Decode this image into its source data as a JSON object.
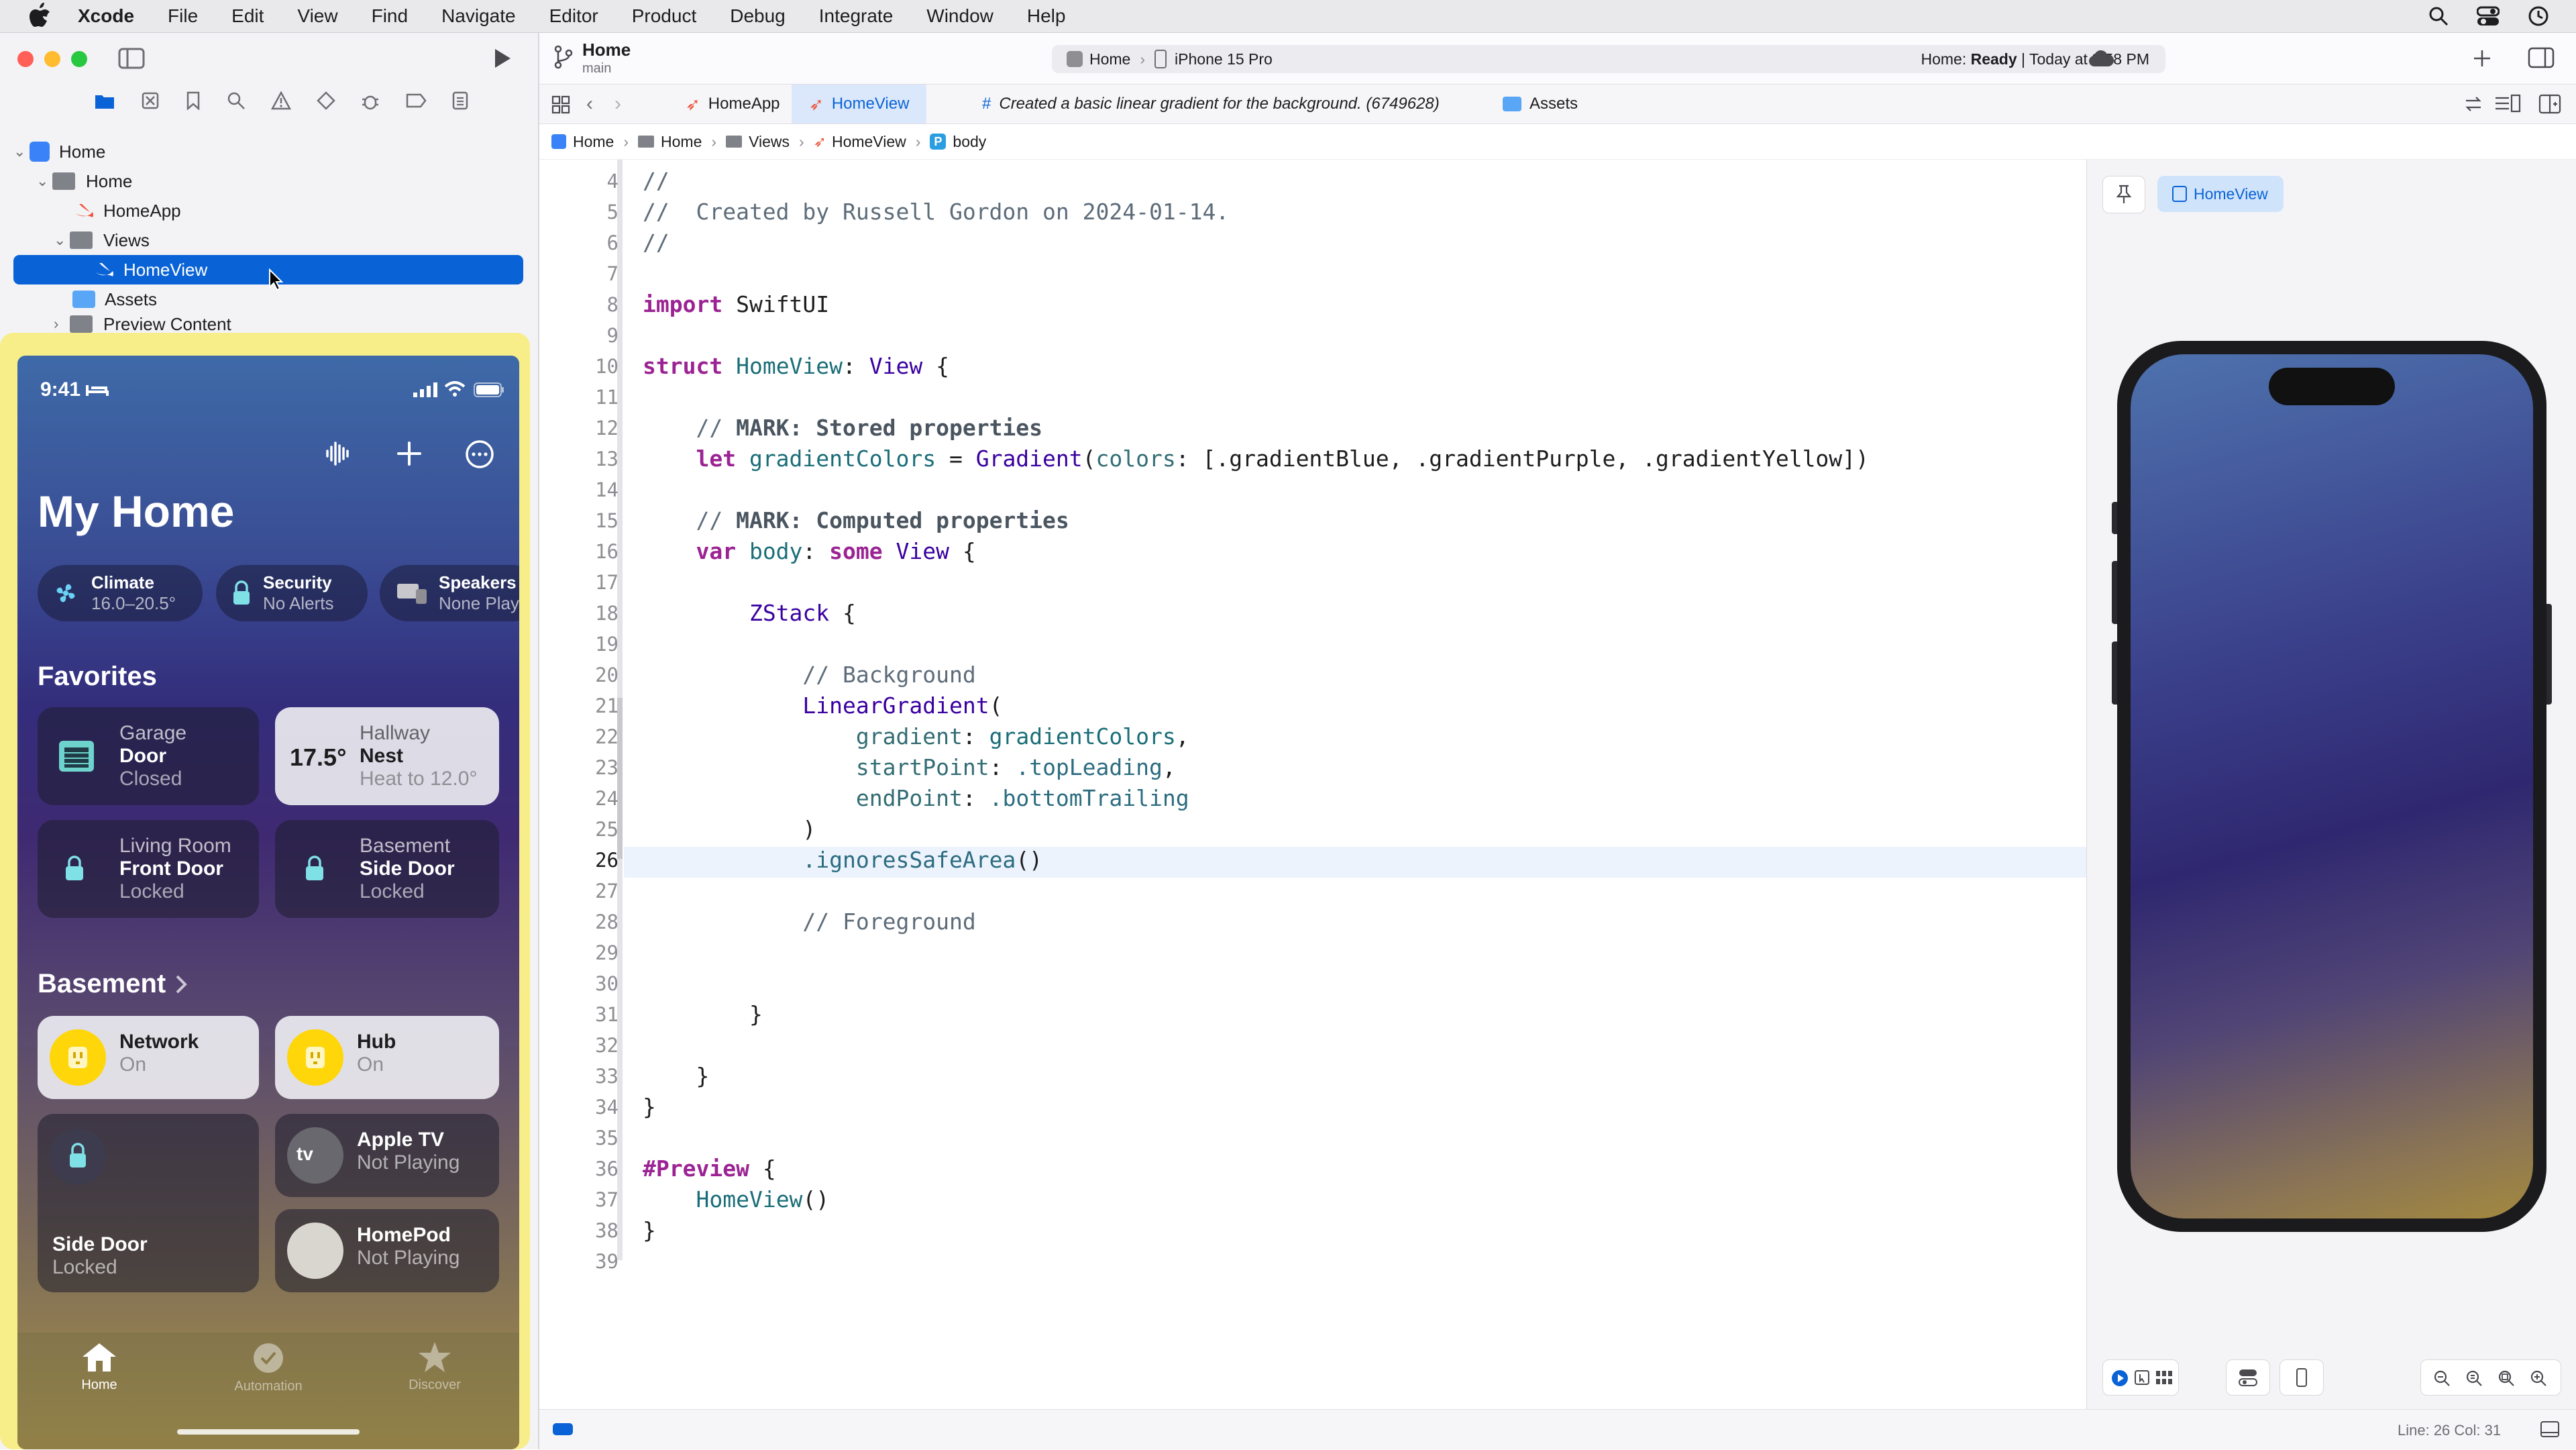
{
  "menubar": {
    "app_name": "Xcode",
    "items": [
      "File",
      "Edit",
      "View",
      "Find",
      "Navigate",
      "Editor",
      "Product",
      "Debug",
      "Integrate",
      "Window",
      "Help"
    ]
  },
  "navigator": {
    "tree": [
      {
        "label": "Home"
      },
      {
        "label": "Home"
      },
      {
        "label": "HomeApp"
      },
      {
        "label": "Views"
      },
      {
        "label": "HomeView"
      },
      {
        "label": "Assets"
      },
      {
        "label": "Preview Content"
      }
    ]
  },
  "simulator": {
    "time": "9:41",
    "title": "My Home",
    "pills": [
      {
        "title": "Climate",
        "sub": "16.0–20.5°"
      },
      {
        "title": "Security",
        "sub": "No Alerts"
      },
      {
        "title": "Speakers",
        "sub": "None Play"
      }
    ],
    "favorites_label": "Favorites",
    "favorites": [
      {
        "room": "Garage",
        "name": "Door",
        "state": "Closed"
      },
      {
        "room": "Hallway",
        "name": "Nest",
        "state": "Heat to 12.0°",
        "value": "17.5°"
      },
      {
        "room": "Living Room",
        "name": "Front Door",
        "state": "Locked"
      },
      {
        "room": "Basement",
        "name": "Side Door",
        "state": "Locked"
      }
    ],
    "basement_label": "Basement",
    "basement": [
      {
        "name": "Network",
        "state": "On"
      },
      {
        "name": "Hub",
        "state": "On"
      },
      {
        "name": "Side Door",
        "state": "Locked"
      },
      {
        "name": "Apple TV",
        "state": "Not Playing",
        "badge": "tv"
      },
      {
        "name": "HomePod",
        "state": "Not Playing"
      }
    ],
    "tabs": [
      {
        "label": "Home"
      },
      {
        "label": "Automation"
      },
      {
        "label": "Discover"
      }
    ]
  },
  "toolbar": {
    "project": "Home",
    "branch": "main",
    "scheme": "Home",
    "device": "iPhone 15 Pro",
    "status_prefix": "Home:",
    "status_state": "Ready",
    "status_time": "| Today at 3:58 PM"
  },
  "tabs": [
    {
      "label": "HomeApp"
    },
    {
      "label": "HomeView"
    },
    {
      "label": "Created a basic linear gradient for the background. (6749628)"
    },
    {
      "label": "Assets"
    }
  ],
  "jumpbar": {
    "items": [
      "Home",
      "Home",
      "Views",
      "HomeView",
      "body"
    ],
    "symbol_badge": "P"
  },
  "code": {
    "current_line": "26",
    "line_numbers": [
      "4",
      "5",
      "6",
      "7",
      "8",
      "9",
      "10",
      "11",
      "12",
      "13",
      "14",
      "15",
      "16",
      "17",
      "18",
      "19",
      "20",
      "21",
      "22",
      "23",
      "24",
      "25",
      "26",
      "27",
      "28",
      "29",
      "30",
      "31",
      "32",
      "33",
      "34",
      "35",
      "36",
      "37",
      "38",
      "39"
    ],
    "lines": {
      "l4": "//",
      "l5": "//  Created by Russell Gordon on 2024-01-14.",
      "l6": "//",
      "l8a": "import",
      "l8b": " SwiftUI",
      "l10a": "struct",
      "l10b": " HomeView",
      "l10c": ": ",
      "l10d": "View",
      "l10e": " {",
      "l12a": "    // ",
      "l12b": "MARK: Stored properties",
      "l13a": "    let",
      "l13b": " gradientColors",
      "l13c": " = ",
      "l13d": "Gradient",
      "l13e": "(",
      "l13f": "colors",
      "l13g": ": [",
      "l13h": ".gradientBlue",
      "l13i": ", ",
      "l13j": ".gradientPurple",
      "l13k": ", ",
      "l13l": ".gradientYellow",
      "l13m": "])",
      "l15a": "    // ",
      "l15b": "MARK: Computed properties",
      "l16a": "    var",
      "l16b": " body",
      "l16c": ": ",
      "l16d": "some",
      "l16e": " View",
      "l16f": " {",
      "l18a": "        ",
      "l18b": "ZStack",
      "l18c": " {",
      "l20": "            // Background",
      "l21a": "            ",
      "l21b": "LinearGradient",
      "l21c": "(",
      "l22a": "                ",
      "l22b": "gradient",
      "l22c": ": ",
      "l22d": "gradientColors",
      "l22e": ",",
      "l23a": "                ",
      "l23b": "startPoint",
      "l23c": ": ",
      "l23d": ".topLeading",
      "l23e": ",",
      "l24a": "                ",
      "l24b": "endPoint",
      "l24c": ": ",
      "l24d": ".bottomTrailing",
      "l25": "            )",
      "l26a": "            ",
      "l26b": ".ignoresSafeArea",
      "l26c": "()",
      "l28": "            // Foreground",
      "l31": "        }",
      "l33": "    }",
      "l34": "}",
      "l36a": "#Preview",
      "l36b": " {",
      "l37a": "    ",
      "l37b": "HomeView",
      "l37c": "()",
      "l38": "}"
    }
  },
  "preview": {
    "pin_icon": "pin-icon",
    "selected_view": "HomeView"
  },
  "status": {
    "position": "Line: 26  Col: 31"
  },
  "colors": {
    "accent": "#0a63d6",
    "keyword": "#9b2393",
    "comment": "#5d6c79"
  }
}
